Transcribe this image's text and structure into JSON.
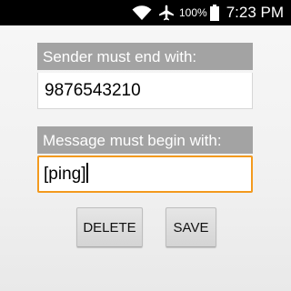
{
  "status_bar": {
    "battery_percent": "100%",
    "time": "7:23 PM",
    "icons": [
      "wifi-icon",
      "airplane-mode-icon",
      "battery-icon"
    ]
  },
  "form": {
    "sender_label": "Sender must end with:",
    "sender_value": "9876543210",
    "message_label": "Message must begin with:",
    "message_value": "[ping]"
  },
  "actions": {
    "delete_label": "DELETE",
    "save_label": "SAVE"
  },
  "colors": {
    "label_bg": "#a3a3a3",
    "focus_border": "#f39a1e",
    "status_bar_bg": "#000000"
  }
}
